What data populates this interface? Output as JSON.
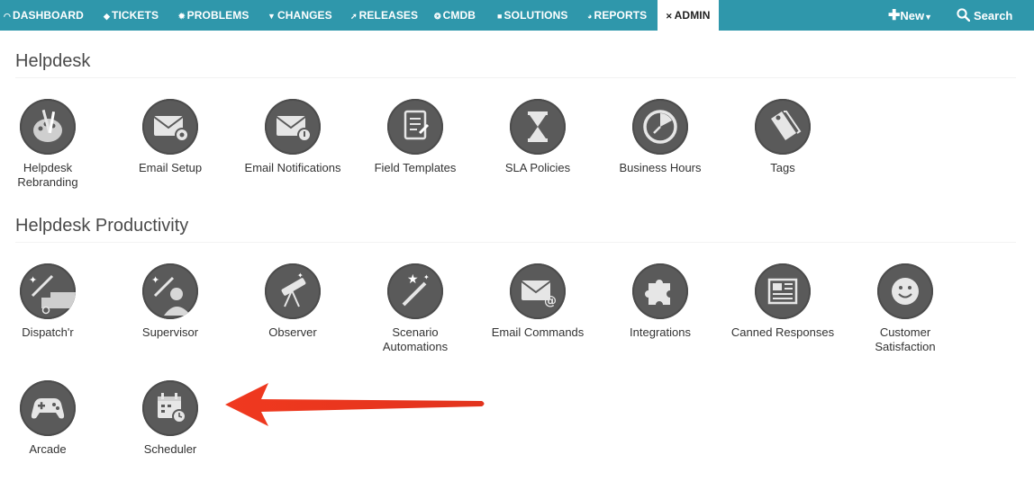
{
  "nav": {
    "items": [
      {
        "label": "DASHBOARD",
        "icon": "dashboard-icon"
      },
      {
        "label": "TICKETS",
        "icon": "ticket-icon"
      },
      {
        "label": "PROBLEMS",
        "icon": "bug-icon"
      },
      {
        "label": "CHANGES",
        "icon": "shield-icon"
      },
      {
        "label": "RELEASES",
        "icon": "rocket-icon"
      },
      {
        "label": "CMDB",
        "icon": "cube-icon"
      },
      {
        "label": "SOLUTIONS",
        "icon": "book-icon"
      },
      {
        "label": "REPORTS",
        "icon": "pie-chart-icon"
      },
      {
        "label": "ADMIN",
        "icon": "tools-icon"
      }
    ],
    "new_label": "New",
    "search_label": "Search"
  },
  "sections": [
    {
      "title": "Helpdesk",
      "tiles": [
        {
          "label": "Helpdesk Rebranding",
          "icon": "palette-icon"
        },
        {
          "label": "Email Setup",
          "icon": "email-gear-icon"
        },
        {
          "label": "Email Notifications",
          "icon": "email-notification-icon"
        },
        {
          "label": "Field Templates",
          "icon": "form-template-icon"
        },
        {
          "label": "SLA Policies",
          "icon": "hourglass-icon"
        },
        {
          "label": "Business Hours",
          "icon": "clock-icon"
        },
        {
          "label": "Tags",
          "icon": "tags-icon"
        }
      ]
    },
    {
      "title": "Helpdesk Productivity",
      "tiles": [
        {
          "label": "Dispatch'r",
          "icon": "dispatch-truck-icon"
        },
        {
          "label": "Supervisor",
          "icon": "supervisor-icon"
        },
        {
          "label": "Observer",
          "icon": "telescope-icon"
        },
        {
          "label": "Scenario Automations",
          "icon": "magic-wand-icon"
        },
        {
          "label": "Email Commands",
          "icon": "email-at-icon"
        },
        {
          "label": "Integrations",
          "icon": "puzzle-icon"
        },
        {
          "label": "Canned Responses",
          "icon": "newspaper-icon"
        },
        {
          "label": "Customer Satisfaction",
          "icon": "smiley-icon"
        },
        {
          "label": "Arcade",
          "icon": "gamepad-icon"
        },
        {
          "label": "Scheduler",
          "icon": "calendar-clock-icon"
        }
      ]
    }
  ],
  "colors": {
    "nav_bg": "#2f97ab",
    "icon_bg": "#5a5a5a",
    "arrow": "#e8321e"
  }
}
